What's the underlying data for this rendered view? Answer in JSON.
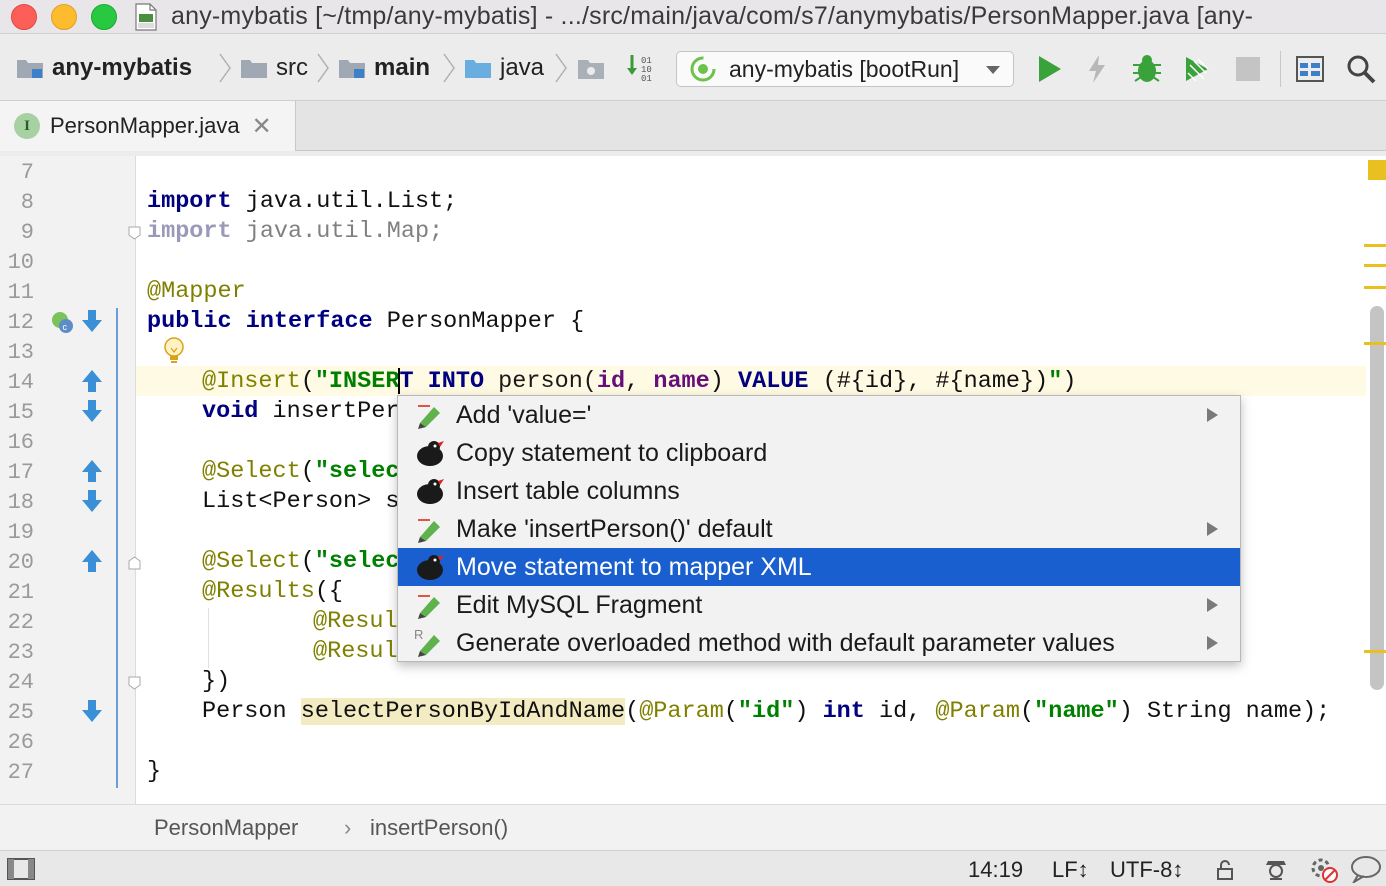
{
  "window": {
    "title": "any-mybatis [~/tmp/any-mybatis] - .../src/main/java/com/s7/anymybatis/PersonMapper.java [any-"
  },
  "navbar": {
    "crumbs": [
      "any-mybatis",
      "src",
      "main",
      "java"
    ],
    "run_config": "any-mybatis [bootRun]"
  },
  "tabs": [
    {
      "label": "PersonMapper.java",
      "icon": "interface-icon",
      "icon_letter": "I"
    }
  ],
  "editor": {
    "line_numbers": [
      "7",
      "8",
      "9",
      "10",
      "11",
      "12",
      "13",
      "14",
      "15",
      "16",
      "17",
      "18",
      "19",
      "20",
      "21",
      "22",
      "23",
      "24",
      "25",
      "26",
      "27"
    ],
    "lines": {
      "l8": [
        "import",
        " java.util.List;"
      ],
      "l9": [
        "import",
        " java.util.Map;"
      ],
      "l11": [
        "@Mapper"
      ],
      "l12": [
        "public",
        " ",
        "interface",
        " PersonMapper {"
      ],
      "l14": [
        "@Insert",
        "(",
        "\"INSER",
        "T INTO",
        " person(",
        "id",
        ", ",
        "name",
        ") ",
        "VALUE",
        " (#{id}, #{name})",
        "\"",
        ")"
      ],
      "l15": [
        "void",
        " insertPer"
      ],
      "l17": [
        "@Select",
        "(",
        "\"selec"
      ],
      "l18": [
        "List<Person> s"
      ],
      "l20": [
        "@Select",
        "(",
        "\"selec"
      ],
      "l21": [
        "@Results",
        "({"
      ],
      "l22": [
        "@Resul"
      ],
      "l23": [
        "@Resul"
      ],
      "l24": [
        "})"
      ],
      "l25": [
        "Person ",
        "selectPersonByIdAndName",
        "(",
        "@Param",
        "(",
        "\"id\"",
        ") ",
        "int",
        " id, ",
        "@Param",
        "(",
        "\"name\"",
        ") String name);"
      ],
      "l27": [
        "}"
      ]
    }
  },
  "popup": {
    "items": [
      {
        "label": "Add 'value='",
        "icon": "pencil-icon",
        "submenu": true,
        "selected": false
      },
      {
        "label": "Copy statement to clipboard",
        "icon": "mybatis-bird-icon",
        "submenu": false,
        "selected": false
      },
      {
        "label": "Insert table columns",
        "icon": "mybatis-bird-icon",
        "submenu": false,
        "selected": false
      },
      {
        "label": "Make 'insertPerson()' default",
        "icon": "pencil-icon",
        "submenu": true,
        "selected": false
      },
      {
        "label": "Move statement to mapper XML",
        "icon": "mybatis-bird-icon",
        "submenu": false,
        "selected": true
      },
      {
        "label": "Edit MySQL Fragment",
        "icon": "pencil-icon",
        "submenu": true,
        "selected": false
      },
      {
        "label": "Generate overloaded method with default parameter values",
        "icon": "pencil-icon",
        "submenu": true,
        "selected": false
      }
    ]
  },
  "breadcrumb": {
    "items": [
      "PersonMapper",
      "insertPerson()"
    ],
    "separator": "›"
  },
  "status": {
    "position": "14:19",
    "line_separator": "LF↕",
    "encoding": "UTF-8↕"
  },
  "colors": {
    "selection": "#1a5fcf",
    "keyword": "#000080",
    "annotation": "#808000",
    "string": "#008000",
    "current_line": "#fffae3"
  }
}
